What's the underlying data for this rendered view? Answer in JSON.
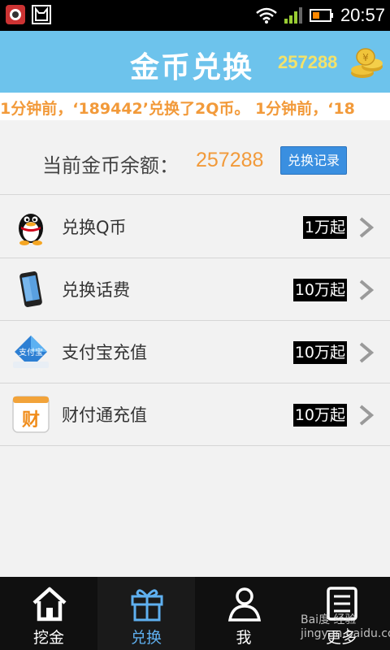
{
  "status_bar": {
    "time": "20:57",
    "icons": [
      "app-icon",
      "cat-icon",
      "wifi-icon",
      "signal-icon",
      "battery-icon"
    ]
  },
  "header": {
    "title": "金币兑换",
    "coins": "257288",
    "coins_icon": "gold-coins-icon"
  },
  "ticker": {
    "text": "1分钟前，‘189442’兑换了2Q币。 1分钟前，‘18"
  },
  "balance": {
    "label": "当前金币余额：",
    "value": "257288",
    "history_button": "兑换记录"
  },
  "items": [
    {
      "label": "兑换Q币",
      "badge": "1万起",
      "icon": "qq-penguin-icon"
    },
    {
      "label": "兑换话费",
      "badge": "10万起",
      "icon": "phone-icon"
    },
    {
      "label": "支付宝充值",
      "badge": "10万起",
      "icon": "alipay-icon"
    },
    {
      "label": "财付通充值",
      "badge": "10万起",
      "icon": "tenpay-icon"
    }
  ],
  "tabs": [
    {
      "label": "挖金",
      "icon": "home-icon"
    },
    {
      "label": "兑换",
      "icon": "gift-icon",
      "active": true
    },
    {
      "label": "我",
      "icon": "user-icon"
    },
    {
      "label": "更多",
      "icon": "list-icon"
    }
  ],
  "watermark": "Bai度 经验 jingyan.baidu.com",
  "colors": {
    "header_bg": "#6dc3ec",
    "accent_orange": "#f29a3a",
    "button_blue": "#3a8fe0",
    "active_tab": "#5fb0f0"
  }
}
